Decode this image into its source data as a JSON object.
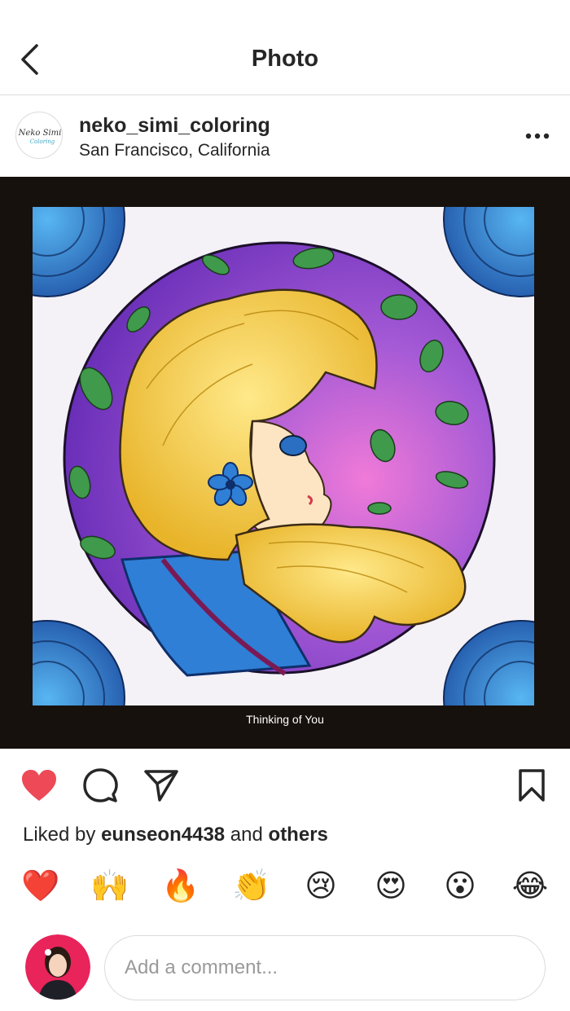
{
  "header": {
    "title": "Photo",
    "back_icon": "chevron-left-icon"
  },
  "post": {
    "username": "neko_simi_coloring",
    "location": "San Francisco, California",
    "avatar_text_top": "Neko Simi",
    "avatar_text_bottom": "Coloring",
    "more_icon": "more-horizontal-icon",
    "image_caption": "Thinking of You"
  },
  "actions": {
    "like_icon": "heart-filled-icon",
    "comment_icon": "comment-icon",
    "share_icon": "paper-plane-icon",
    "save_icon": "bookmark-icon",
    "like_color": "#ed4956"
  },
  "likes": {
    "prefix": "Liked by ",
    "user": "eunseon4438",
    "middle": " and ",
    "others": "others"
  },
  "quick_reactions": [
    "❤️",
    "🙌",
    "🔥",
    "👏",
    "😢",
    "😍",
    "😮",
    "😂"
  ],
  "comment": {
    "placeholder": "Add a comment..."
  }
}
